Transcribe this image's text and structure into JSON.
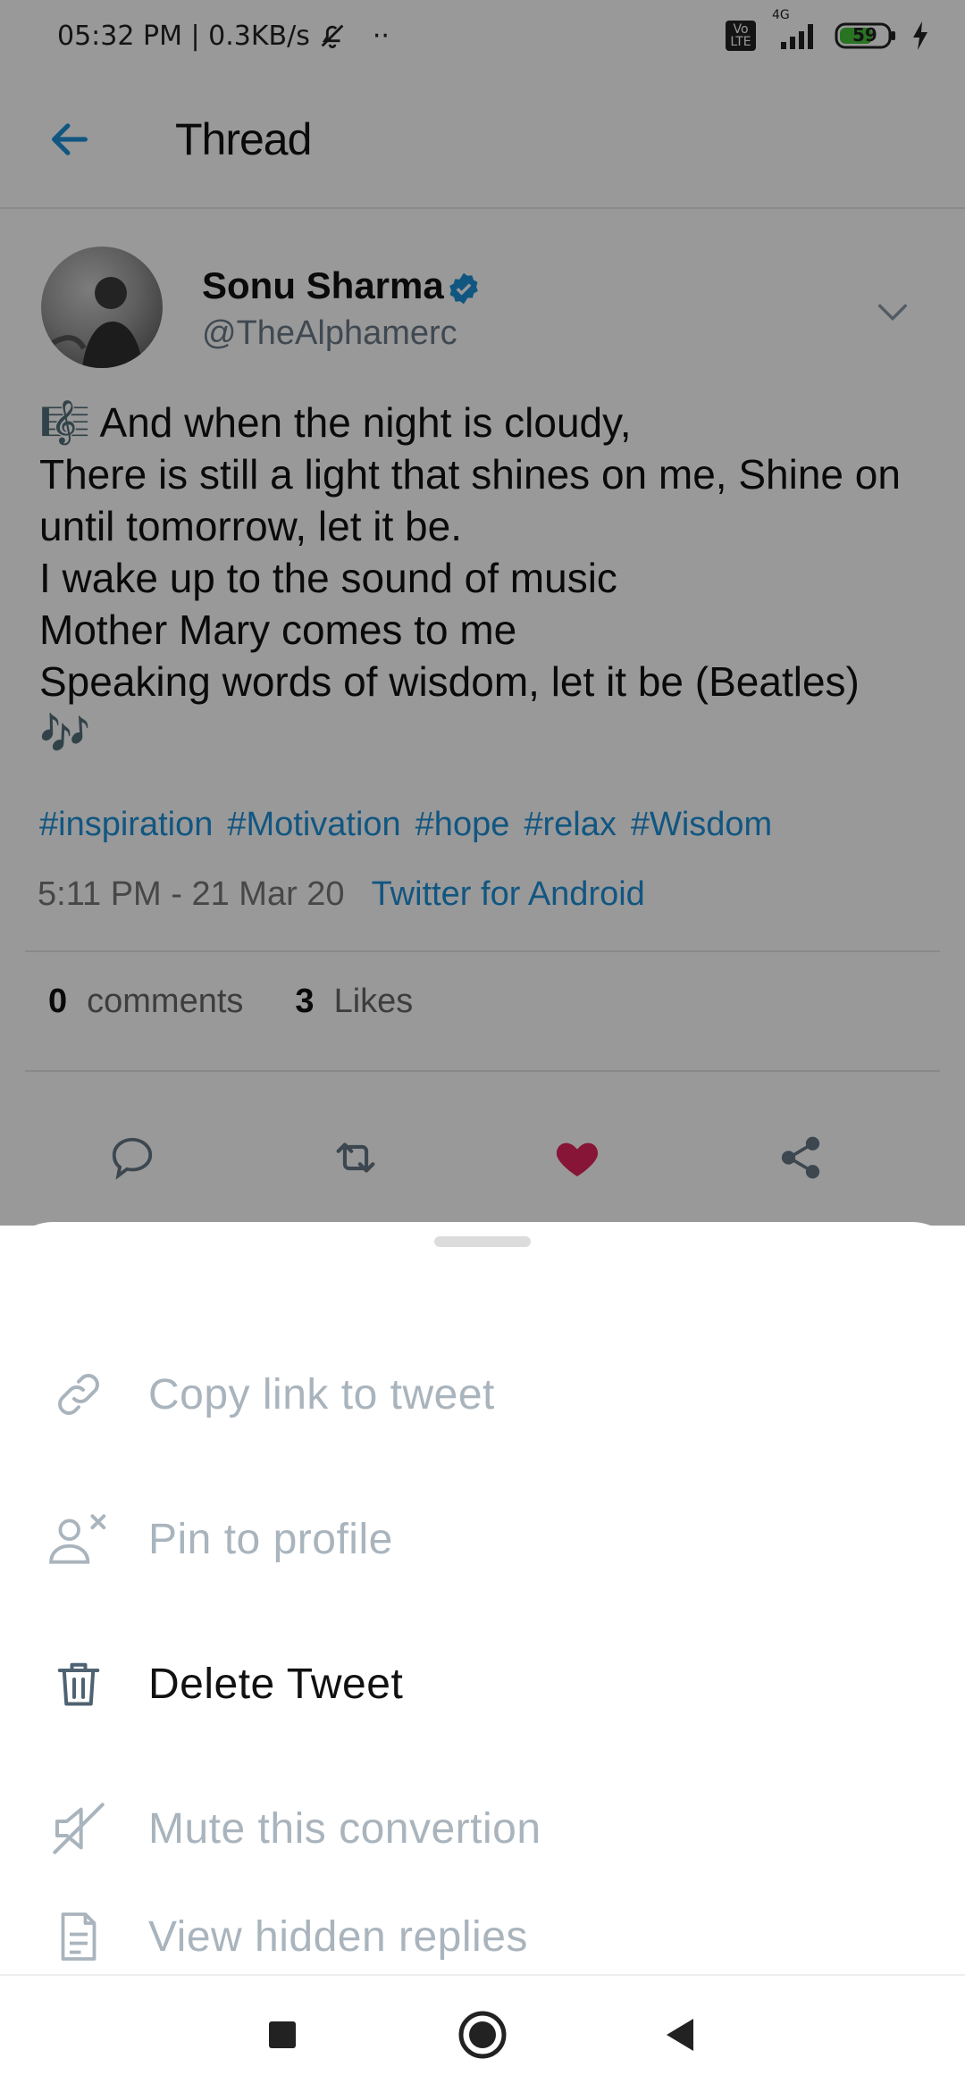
{
  "status_bar": {
    "time_speed": "05:32 PM | 0.3KB/s",
    "dots": "··",
    "volte": "Vo LTE",
    "network": "4G",
    "battery": "59"
  },
  "header": {
    "title": "Thread"
  },
  "tweet": {
    "author_name": "Sonu Sharma",
    "author_handle": "@TheAlphamerc",
    "body": "🎼 And when the night is cloudy,\nThere is still a light that shines on me, Shine on until tomorrow, let it be.\nI wake up to the sound of music\nMother Mary comes to me\nSpeaking words of wisdom, let it be (Beatles)\n🎶",
    "hashtags": [
      "#inspiration",
      "#Motivation",
      "#hope",
      "#relax",
      "#Wisdom"
    ],
    "time": "5:11 PM - 21 Mar 20",
    "source": "Twitter for Android",
    "comments_count": "0",
    "comments_label": "comments",
    "likes_count": "3",
    "likes_label": "Likes",
    "liked": true
  },
  "sheet": {
    "items": [
      {
        "label": "Copy link to tweet",
        "icon": "link-icon",
        "enabled": false
      },
      {
        "label": "Pin to profile",
        "icon": "pin-user-icon",
        "enabled": false
      },
      {
        "label": "Delete Tweet",
        "icon": "trash-icon",
        "enabled": true
      },
      {
        "label": "Mute this convertion",
        "icon": "mute-icon",
        "enabled": false
      },
      {
        "label": "View hidden replies",
        "icon": "document-icon",
        "enabled": false
      }
    ]
  },
  "colors": {
    "accent": "#1d8fd8",
    "like": "#e0245e",
    "disabled_text": "#a9b4bd",
    "overlay": "rgba(0,0,0,0.40)"
  }
}
